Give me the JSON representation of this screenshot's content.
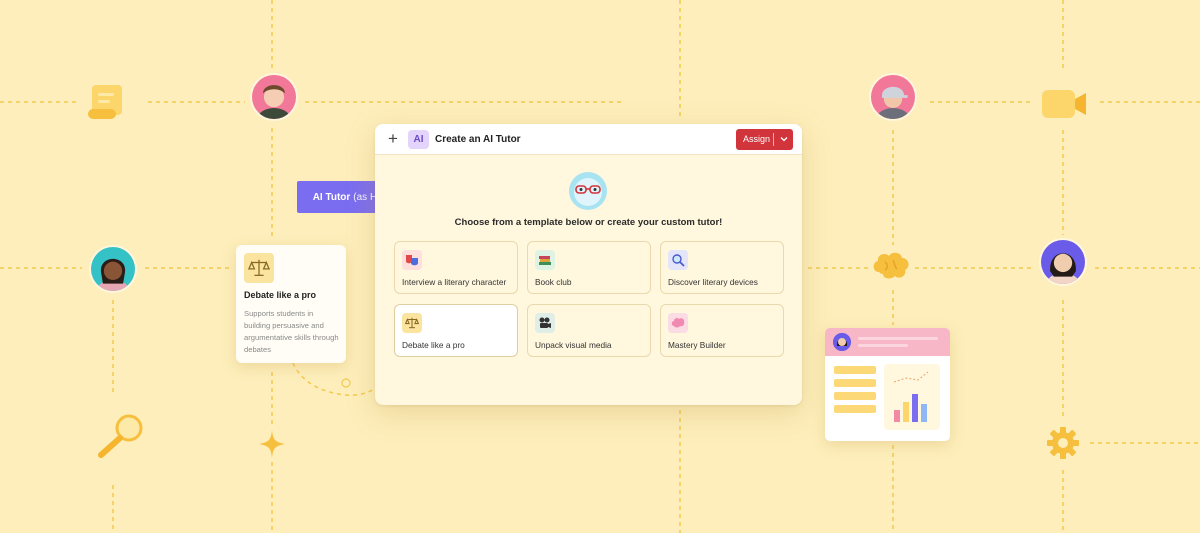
{
  "colors": {
    "background": "#fdeebb",
    "grid_line": "#f5c84e",
    "accent_purple": "#7b6df0",
    "assign_red": "#d2343c",
    "ai_badge_bg": "#e4d4fb"
  },
  "modal": {
    "plus_icon": "plus-icon",
    "ai_badge": "AI",
    "title": "Create an AI Tutor",
    "assign_label": "Assign",
    "prompt": "Choose from a template below or create your custom tutor!",
    "templates": [
      {
        "label": "Interview a literary character",
        "icon": "theater-masks-icon",
        "selected": false
      },
      {
        "label": "Book club",
        "icon": "books-icon",
        "selected": false
      },
      {
        "label": "Discover literary devices",
        "icon": "magnifier-icon",
        "selected": false
      },
      {
        "label": "Debate like a pro",
        "icon": "scales-icon",
        "selected": true
      },
      {
        "label": "Unpack visual media",
        "icon": "film-camera-icon",
        "selected": false
      },
      {
        "label": "Mastery Builder",
        "icon": "brain-icon",
        "selected": false
      }
    ]
  },
  "tutor_tip": {
    "name": "AI Tutor",
    "persona": "(as Huck Finn)"
  },
  "debate_card": {
    "title": "Debate like a pro",
    "description": "Supports students in building persuasive and argumentative skills through debates",
    "icon": "scales-icon"
  },
  "decorations": {
    "icons": [
      "scroll-icon",
      "video-camera-icon",
      "brain-icon",
      "magnifying-glass-icon",
      "sparkle-icon",
      "gear-icon"
    ],
    "avatars": [
      "student-avatar",
      "student-avatar",
      "student-avatar",
      "student-avatar"
    ]
  }
}
